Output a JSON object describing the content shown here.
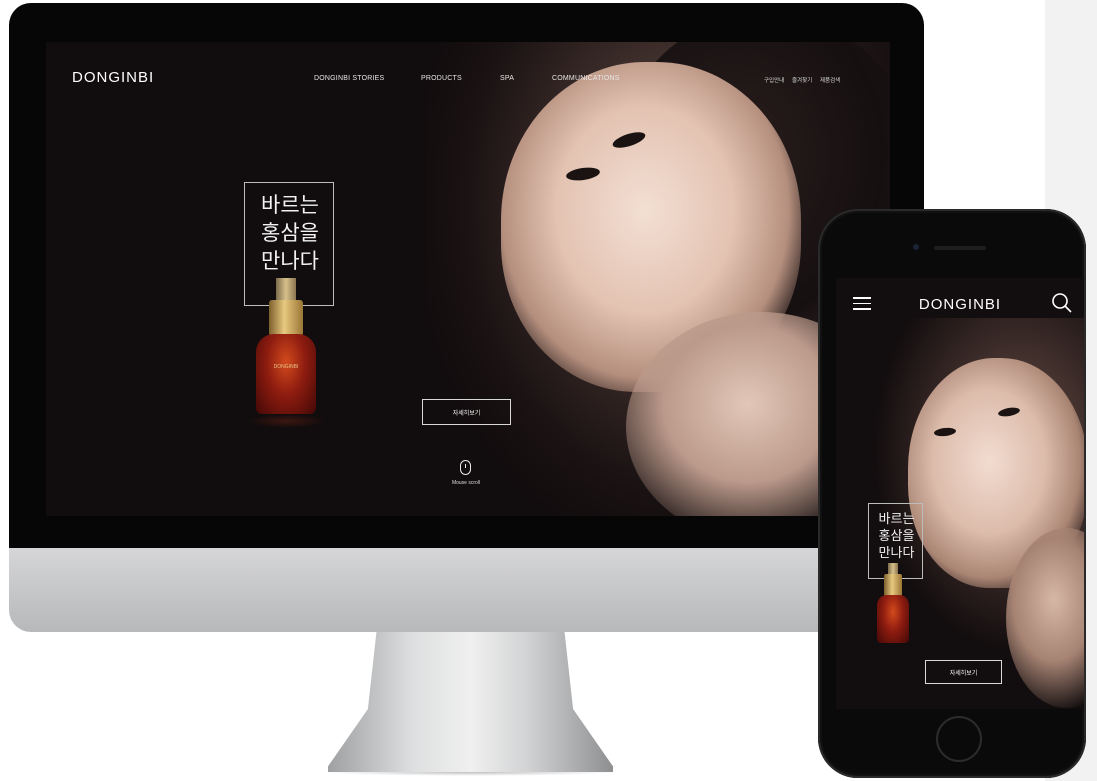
{
  "desktop": {
    "logo": "DONGINBI",
    "nav": [
      {
        "label": "DONGINBI STORIES"
      },
      {
        "label": "PRODUCTS"
      },
      {
        "label": "SPA"
      },
      {
        "label": "COMMUNICATIONS"
      }
    ],
    "utility": [
      "구입안내",
      "즐겨찾기",
      "제품검색"
    ],
    "hero_title": [
      "바르는",
      "홍삼을",
      "만나다"
    ],
    "product_label": "DONGINBI",
    "cta": "자세히보기",
    "scroll_label": "Mouse scroll"
  },
  "mobile": {
    "logo": "DONGINBI",
    "hero_title": [
      "바르는",
      "홍삼을",
      "만나다"
    ],
    "cta": "자세히보기",
    "icons": {
      "menu": "hamburger-menu-icon",
      "search": "search-icon"
    }
  },
  "colors": {
    "background": "#110c0d",
    "text": "#ffffff",
    "product_red": "#8e1c10",
    "product_gold": "#e8c980"
  }
}
